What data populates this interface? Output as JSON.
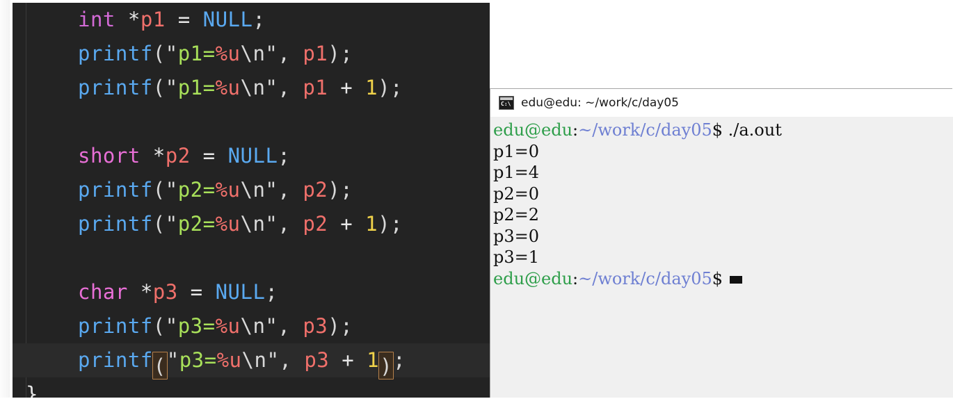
{
  "editor": {
    "theme": "dark",
    "background": "#232323",
    "current_line_background": "#2b2b2b",
    "bracket_match_border": "#b5804a",
    "lines": [
      {
        "indent": true,
        "tokens": [
          {
            "text": "int",
            "cls": "t-kw"
          },
          {
            "text": " ",
            "cls": "t-punct"
          },
          {
            "text": "*",
            "cls": "t-op"
          },
          {
            "text": "p1",
            "cls": "t-ident"
          },
          {
            "text": " = ",
            "cls": "t-op"
          },
          {
            "text": "NULL",
            "cls": "t-const"
          },
          {
            "text": ";",
            "cls": "t-punct"
          }
        ]
      },
      {
        "indent": true,
        "tokens": [
          {
            "text": "printf",
            "cls": "t-fn"
          },
          {
            "text": "(\"",
            "cls": "t-punct"
          },
          {
            "text": "p1=",
            "cls": "t-str"
          },
          {
            "text": "%u",
            "cls": "t-fmt"
          },
          {
            "text": "\\n",
            "cls": "t-esc"
          },
          {
            "text": "\", ",
            "cls": "t-punct"
          },
          {
            "text": "p1",
            "cls": "t-ident"
          },
          {
            "text": ");",
            "cls": "t-punct"
          }
        ]
      },
      {
        "indent": true,
        "tokens": [
          {
            "text": "printf",
            "cls": "t-fn"
          },
          {
            "text": "(\"",
            "cls": "t-punct"
          },
          {
            "text": "p1=",
            "cls": "t-str"
          },
          {
            "text": "%u",
            "cls": "t-fmt"
          },
          {
            "text": "\\n",
            "cls": "t-esc"
          },
          {
            "text": "\", ",
            "cls": "t-punct"
          },
          {
            "text": "p1",
            "cls": "t-ident"
          },
          {
            "text": " + ",
            "cls": "t-op"
          },
          {
            "text": "1",
            "cls": "t-num"
          },
          {
            "text": ");",
            "cls": "t-punct"
          }
        ]
      },
      {
        "indent": true,
        "tokens": []
      },
      {
        "indent": true,
        "tokens": [
          {
            "text": "short",
            "cls": "t-kw2"
          },
          {
            "text": " ",
            "cls": "t-punct"
          },
          {
            "text": "*",
            "cls": "t-op"
          },
          {
            "text": "p2",
            "cls": "t-ident"
          },
          {
            "text": " = ",
            "cls": "t-op"
          },
          {
            "text": "NULL",
            "cls": "t-const"
          },
          {
            "text": ";",
            "cls": "t-punct"
          }
        ]
      },
      {
        "indent": true,
        "tokens": [
          {
            "text": "printf",
            "cls": "t-fn"
          },
          {
            "text": "(\"",
            "cls": "t-punct"
          },
          {
            "text": "p2=",
            "cls": "t-str"
          },
          {
            "text": "%u",
            "cls": "t-fmt"
          },
          {
            "text": "\\n",
            "cls": "t-esc"
          },
          {
            "text": "\", ",
            "cls": "t-punct"
          },
          {
            "text": "p2",
            "cls": "t-ident"
          },
          {
            "text": ");",
            "cls": "t-punct"
          }
        ]
      },
      {
        "indent": true,
        "tokens": [
          {
            "text": "printf",
            "cls": "t-fn"
          },
          {
            "text": "(\"",
            "cls": "t-punct"
          },
          {
            "text": "p2=",
            "cls": "t-str"
          },
          {
            "text": "%u",
            "cls": "t-fmt"
          },
          {
            "text": "\\n",
            "cls": "t-esc"
          },
          {
            "text": "\", ",
            "cls": "t-punct"
          },
          {
            "text": "p2",
            "cls": "t-ident"
          },
          {
            "text": " + ",
            "cls": "t-op"
          },
          {
            "text": "1",
            "cls": "t-num"
          },
          {
            "text": ");",
            "cls": "t-punct"
          }
        ]
      },
      {
        "indent": true,
        "tokens": []
      },
      {
        "indent": true,
        "tokens": [
          {
            "text": "char",
            "cls": "t-kw2"
          },
          {
            "text": " ",
            "cls": "t-punct"
          },
          {
            "text": "*",
            "cls": "t-op"
          },
          {
            "text": "p3",
            "cls": "t-ident"
          },
          {
            "text": " = ",
            "cls": "t-op"
          },
          {
            "text": "NULL",
            "cls": "t-const"
          },
          {
            "text": ";",
            "cls": "t-punct"
          }
        ]
      },
      {
        "indent": true,
        "tokens": [
          {
            "text": "printf",
            "cls": "t-fn"
          },
          {
            "text": "(\"",
            "cls": "t-punct"
          },
          {
            "text": "p3=",
            "cls": "t-str"
          },
          {
            "text": "%u",
            "cls": "t-fmt"
          },
          {
            "text": "\\n",
            "cls": "t-esc"
          },
          {
            "text": "\", ",
            "cls": "t-punct"
          },
          {
            "text": "p3",
            "cls": "t-ident"
          },
          {
            "text": ");",
            "cls": "t-punct"
          }
        ]
      },
      {
        "indent": true,
        "current": true,
        "tokens": [
          {
            "text": "printf",
            "cls": "t-fn"
          },
          {
            "text": "(",
            "cls": "t-punct",
            "bracket_match": true
          },
          {
            "text": "\"",
            "cls": "t-punct"
          },
          {
            "text": "p3=",
            "cls": "t-str"
          },
          {
            "text": "%u",
            "cls": "t-fmt"
          },
          {
            "text": "\\n",
            "cls": "t-esc"
          },
          {
            "text": "\", ",
            "cls": "t-punct"
          },
          {
            "text": "p3",
            "cls": "t-ident"
          },
          {
            "text": " + ",
            "cls": "t-op"
          },
          {
            "text": "1",
            "cls": "t-num"
          },
          {
            "text": ")",
            "cls": "t-punct",
            "bracket_match": true
          },
          {
            "text": ";",
            "cls": "t-punct"
          }
        ]
      },
      {
        "indent": false,
        "tokens": [
          {
            "text": "}",
            "cls": "t-brace"
          }
        ]
      }
    ]
  },
  "terminal": {
    "title": "edu@edu: ~/work/c/day05",
    "icon": "terminal-console-icon",
    "icon_label": "C:\\",
    "title_bar_background": "#ffffff",
    "body_background": "#f0f0f0",
    "prompt": {
      "user_host": "edu@edu",
      "separator": ":",
      "path": "~/work/c/day05",
      "sigil": "$"
    },
    "colors": {
      "user_host": "#2e9e4a",
      "path": "#6e7fd2",
      "text": "#111111"
    },
    "lines": [
      {
        "type": "prompt",
        "command": " ./a.out"
      },
      {
        "type": "output",
        "text": "p1=0"
      },
      {
        "type": "output",
        "text": "p1=4"
      },
      {
        "type": "output",
        "text": "p2=0"
      },
      {
        "type": "output",
        "text": "p2=2"
      },
      {
        "type": "output",
        "text": "p3=0"
      },
      {
        "type": "output",
        "text": "p3=1"
      },
      {
        "type": "prompt",
        "command": "",
        "cursor": true
      }
    ]
  }
}
